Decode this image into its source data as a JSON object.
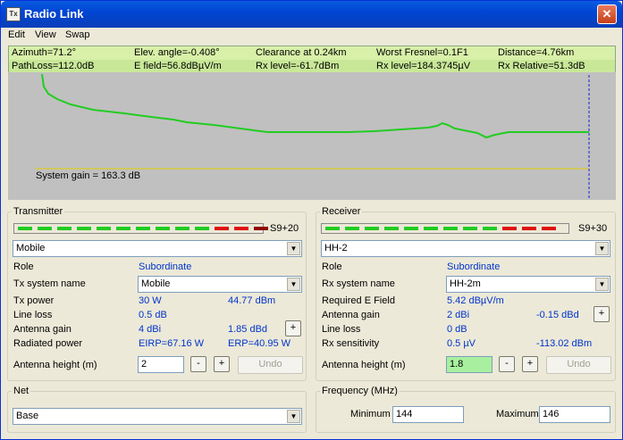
{
  "window": {
    "title": "Radio Link",
    "close": "✕",
    "icon": "Tx"
  },
  "menu": {
    "edit": "Edit",
    "view": "View",
    "swap": "Swap"
  },
  "info": {
    "row1": [
      "Azimuth=71.2°",
      "Elev. angle=-0.408°",
      "Clearance at 0.24km",
      "Worst Fresnel=0.1F1",
      "Distance=4.76km"
    ],
    "row2": [
      "PathLoss=112.0dB",
      "E field=56.8dBµV/m",
      "Rx level=-61.7dBm",
      "Rx level=184.3745µV",
      "Rx Relative=51.3dB"
    ]
  },
  "chart_data": {
    "type": "line",
    "annotation": "System gain = 163.3 dB",
    "profile_color": "#22cc22",
    "gain_line_color": "#e0d000",
    "marker_line_color": "#2020cc"
  },
  "transmitter": {
    "legend": "Transmitter",
    "meter_label": "S9+20",
    "meter_segments": [
      "#22cc22",
      "#22cc22",
      "#22cc22",
      "#22cc22",
      "#22cc22",
      "#22cc22",
      "#22cc22",
      "#22cc22",
      "#22cc22",
      "#22cc22",
      "#e01010",
      "#e01010",
      "#900000"
    ],
    "device": "Mobile",
    "role_label": "Role",
    "role_value": "Subordinate",
    "system_label": "Tx system name",
    "system_value": "Mobile",
    "power_label": "Tx power",
    "power_w": "30 W",
    "power_dbm": "44.77 dBm",
    "loss_label": "Line loss",
    "loss_value": "0.5 dB",
    "gain_label": "Antenna gain",
    "gain_dbi": "4 dBi",
    "gain_dbd": "1.85 dBd",
    "radiated_label": "Radiated power",
    "eirp": "EIRP=67.16 W",
    "erp": "ERP=40.95 W",
    "height_label": "Antenna height (m)",
    "height_value": "2",
    "minus": "-",
    "plus": "+",
    "undo": "Undo"
  },
  "receiver": {
    "legend": "Receiver",
    "meter_label": "S9+30",
    "meter_segments": [
      "#22cc22",
      "#22cc22",
      "#22cc22",
      "#22cc22",
      "#22cc22",
      "#22cc22",
      "#22cc22",
      "#22cc22",
      "#22cc22",
      "#e01010",
      "#e01010",
      "#e01010"
    ],
    "device": "HH-2",
    "role_label": "Role",
    "role_value": "Subordinate",
    "system_label": "Rx system name",
    "system_value": "HH-2m",
    "field_label": "Required E Field",
    "field_value": "5.42 dBµV/m",
    "gain_label": "Antenna gain",
    "gain_dbi": "2 dBi",
    "gain_dbd": "-0.15 dBd",
    "loss_label": "Line loss",
    "loss_value": "0 dB",
    "sens_label": "Rx sensitivity",
    "sens_uv": "0.5 µV",
    "sens_dbm": "-113.02 dBm",
    "height_label": "Antenna height (m)",
    "height_value": "1.8",
    "minus": "-",
    "plus": "+",
    "undo": "Undo"
  },
  "net": {
    "legend": "Net",
    "value": "Base"
  },
  "frequency": {
    "legend": "Frequency (MHz)",
    "min_label": "Minimum",
    "min_value": "144",
    "max_label": "Maximum",
    "max_value": "146"
  }
}
